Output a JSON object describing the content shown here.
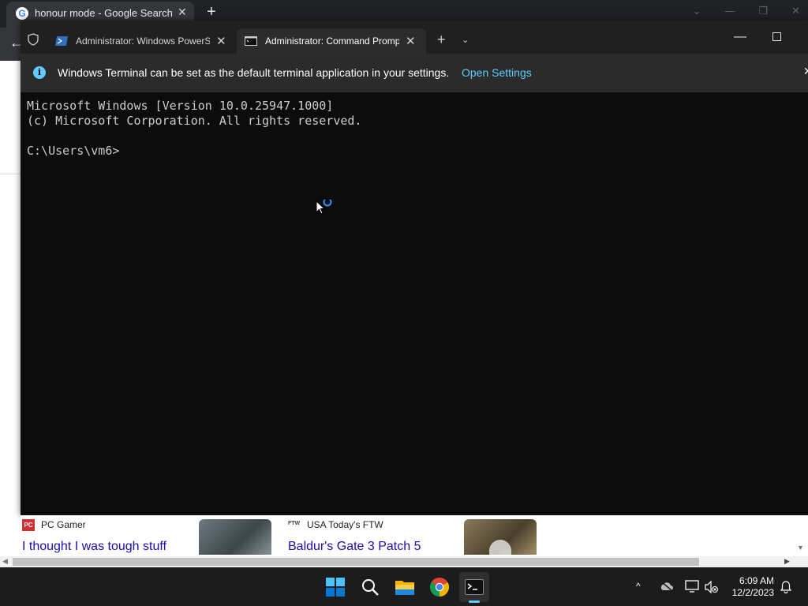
{
  "browser": {
    "tab_title": "honour mode - Google Search",
    "tab_favicon": "G",
    "tab_close": "✕",
    "new_tab": "+",
    "back_arrow": "←",
    "window_controls": [
      "⌄",
      "—",
      "❐",
      "✕"
    ]
  },
  "terminal": {
    "tabs": [
      {
        "label": "Administrator: Windows PowerShell",
        "icon": "powershell-icon",
        "close": "✕"
      },
      {
        "label": "Administrator: Command Prompt",
        "icon": "cmd-icon",
        "close": "✕",
        "active": true
      }
    ],
    "new_tab": "+",
    "dropdown": "⌄",
    "minimize": "—",
    "infobar": {
      "icon": "i",
      "text": "Windows Terminal can be set as the default terminal application in your settings.",
      "link": "Open Settings",
      "close": "✕"
    },
    "console_lines": "Microsoft Windows [Version 10.0.25947.1000]\n(c) Microsoft Corporation. All rights reserved.\n\nC:\\Users\\vm6>"
  },
  "results": {
    "item1": {
      "logo": "PC",
      "source": "PC Gamer",
      "title": "I thought I was tough stuff"
    },
    "item2": {
      "logo": "FTW",
      "source": "USA Today's FTW",
      "title": "Baldur's Gate 3 Patch 5"
    },
    "scroll_left": "◀",
    "scroll_right": "▶",
    "scroll_down": "▼"
  },
  "taskbar": {
    "tray_chevron": "^",
    "time": "6:09 AM",
    "date": "12/2/2023"
  },
  "colors": {
    "accent": "#60cdff",
    "terminal_bg": "#0c0c0c"
  }
}
